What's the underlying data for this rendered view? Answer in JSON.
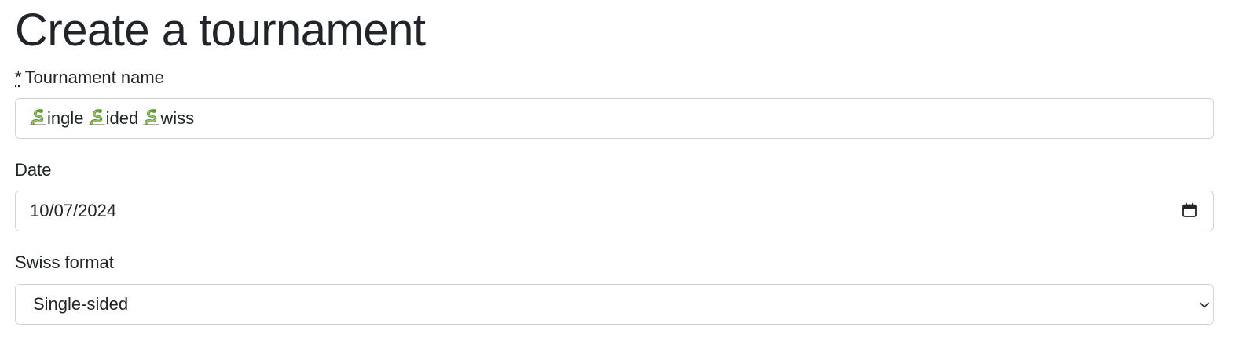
{
  "page": {
    "title": "Create a tournament"
  },
  "form": {
    "name": {
      "required_marker": "*",
      "label": "Tournament name",
      "value_parts": [
        "ingle ",
        "ided ",
        "wiss"
      ],
      "value_icon": "snake-emoji"
    },
    "date": {
      "label": "Date",
      "value": "10/07/2024",
      "icon": "calendar-icon"
    },
    "format": {
      "label": "Swiss format",
      "selected": "Single-sided",
      "icon": "chevron-down-icon"
    }
  },
  "colors": {
    "text": "#212529",
    "border": "#ced4da",
    "background": "#ffffff",
    "snake": "#7cb342"
  }
}
